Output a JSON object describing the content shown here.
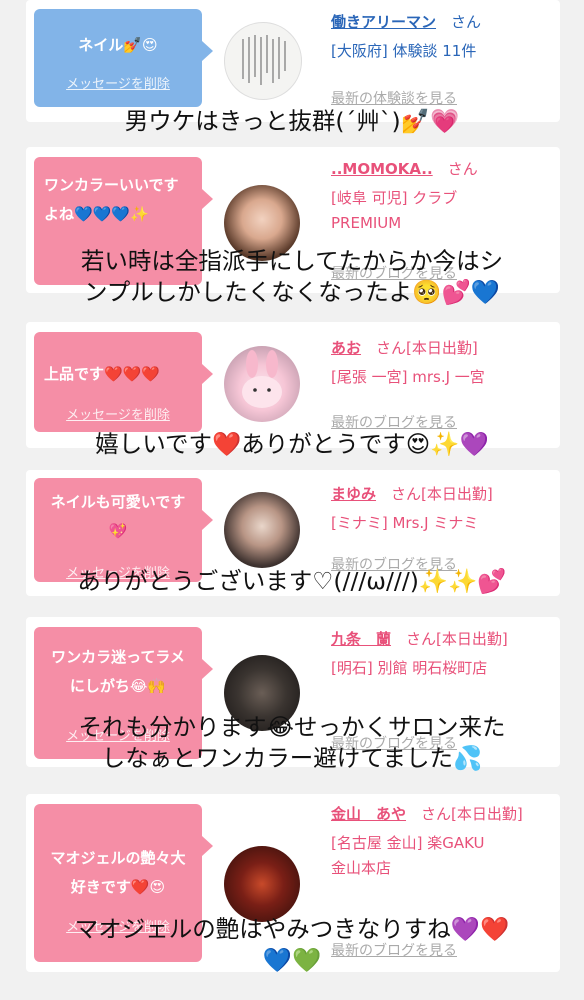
{
  "colors": {
    "bubble_blue": "#82b4e8",
    "bubble_pink": "#f58ea6",
    "name_blue": "#2a66b8",
    "name_pink": "#e8517a",
    "link_gray": "#aaaaaa"
  },
  "cards": [
    {
      "message": "ネイル💅😍",
      "delete_label": "メッセージを削除",
      "name": "働きアリーマン",
      "suffix": "さん",
      "line1": "[大阪府] 体験談 11件",
      "line2": "",
      "link": "最新の体験談を見る",
      "overlay": [
        "男ウケはきっと抜群(´艸`)💅💗"
      ]
    },
    {
      "message": "ワンカラーいいですよね💙💙💙✨",
      "delete_label": "",
      "name": "..MOMOKA..",
      "suffix": "さん",
      "line1": "[岐阜 可児] クラブ",
      "line2": "PREMIUM",
      "link": "最新のブログを見る",
      "overlay": [
        "若い時は全指派手にしてたからか今はシ",
        "ンプルしかしたくなくなったよ🥺💕💙"
      ]
    },
    {
      "message": "上品です❤️❤️❤️",
      "delete_label": "メッセージを削除",
      "name": "あお",
      "suffix": "さん[本日出勤]",
      "line1": "[尾張 一宮] mrs.J 一宮",
      "line2": "",
      "link": "最新のブログを見る",
      "overlay": [
        "嬉しいです❤️ありがとうです😍✨💜"
      ]
    },
    {
      "message": "ネイルも可愛いです💖",
      "delete_label": "メッセージを削除",
      "name": "まゆみ",
      "suffix": "さん[本日出勤]",
      "line1": "[ミナミ] Mrs.J ミナミ",
      "line2": "",
      "link": "最新のブログを見る",
      "overlay": [
        "ありがとうございます♡(///ω///)✨✨💕"
      ]
    },
    {
      "message": "ワンカラ迷ってラメにしがち😂🙌",
      "delete_label": "メッセージを削除",
      "name": "九条　蘭",
      "suffix": "さん[本日出勤]",
      "line1": "[明石] 別館 明石桜町店",
      "line2": "",
      "link": "最新のブログを見る",
      "overlay": [
        "それも分かります😂せっかくサロン来た",
        "しなぁとワンカラー避けてました💦"
      ]
    },
    {
      "message": "マオジェルの艶々大好きです❤️😍",
      "delete_label": "メッセージを削除",
      "name": "金山　あや",
      "suffix": "さん[本日出勤]",
      "line1": "[名古屋 金山] 楽GAKU",
      "line2": "金山本店",
      "link": "最新のブログを見る",
      "overlay": [
        "マオジェルの艶はやみつきなりすね💜❤️",
        "💙💚"
      ]
    }
  ]
}
